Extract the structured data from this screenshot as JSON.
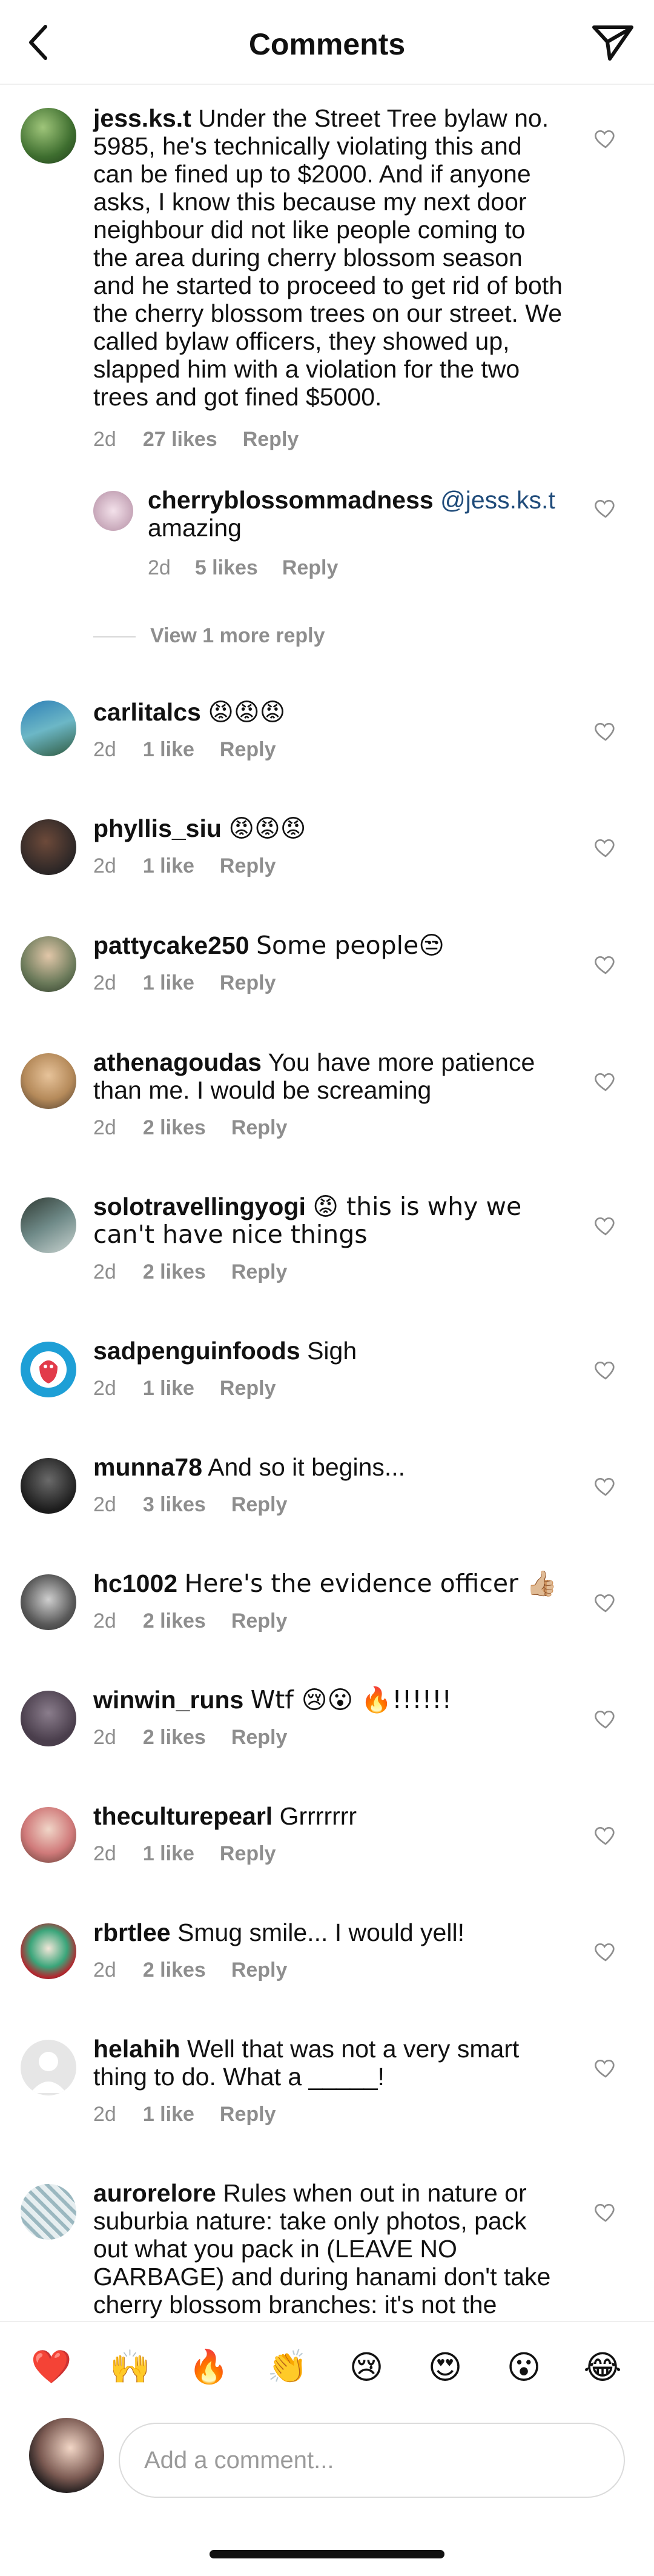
{
  "header": {
    "title": "Comments",
    "back_icon": "chevron-left-icon",
    "send_icon": "paper-plane-icon"
  },
  "comments": [
    {
      "user": "jess.ks.t",
      "text": "Under the Street Tree bylaw no. 5985, he's technically violating this and can be fined up to $2000.  And if anyone asks, I know this because my next door neighbour did not like people coming to the area during cherry blossom season and he started to proceed to get rid of both the  cherry blossom trees on our street.  We called bylaw officers, they showed up, slapped him with a violation for the two trees and got fined $5000.",
      "time": "2d",
      "likes": "27 likes",
      "reply": "Reply"
    },
    {
      "user": "cherryblossommadness",
      "mention": "@jess.ks.t",
      "text": "amazing",
      "time": "2d",
      "likes": "5 likes",
      "reply": "Reply"
    },
    {
      "user": "carlitalcs",
      "text": "😡😡😡",
      "time": "2d",
      "likes": "1 like",
      "reply": "Reply"
    },
    {
      "user": "phyllis_siu",
      "text": "😡😡😡",
      "time": "2d",
      "likes": "1 like",
      "reply": "Reply"
    },
    {
      "user": "pattycake250",
      "text": "Some people😒",
      "time": "2d",
      "likes": "1 like",
      "reply": "Reply"
    },
    {
      "user": "athenagoudas",
      "text": "You have more patience than me. I would be screaming",
      "time": "2d",
      "likes": "2 likes",
      "reply": "Reply"
    },
    {
      "user": "solotravellingyogi",
      "text": "😡 this is why we can't have nice things",
      "time": "2d",
      "likes": "2 likes",
      "reply": "Reply"
    },
    {
      "user": "sadpenguinfoods",
      "text": "Sigh",
      "time": "2d",
      "likes": "1 like",
      "reply": "Reply"
    },
    {
      "user": "munna78",
      "text": "And so it begins...",
      "time": "2d",
      "likes": "3 likes",
      "reply": "Reply"
    },
    {
      "user": "hc1002",
      "text": "Here's the evidence officer 👍🏼",
      "time": "2d",
      "likes": "2 likes",
      "reply": "Reply"
    },
    {
      "user": "winwin_runs",
      "text": "Wtf 😢😮 🔥!!!!!!",
      "time": "2d",
      "likes": "2 likes",
      "reply": "Reply"
    },
    {
      "user": "theculturepearl",
      "text": "Grrrrrrr",
      "time": "2d",
      "likes": "1 like",
      "reply": "Reply"
    },
    {
      "user": "rbrtlee",
      "text": "Smug smile... I would yell!",
      "time": "2d",
      "likes": "2 likes",
      "reply": "Reply"
    },
    {
      "user": "helahih",
      "text": "Well that was not a very smart thing to do. What a _____!",
      "time": "2d",
      "likes": "1 like",
      "reply": "Reply"
    },
    {
      "user": "aurorelore",
      "text": "Rules when out in nature or suburbia nature: take only photos,  pack out what you pack in (LEAVE NO GARBAGE) and during hanami  don't take cherry blossom branches: it's not the",
      "time": "",
      "likes": "",
      "reply": ""
    }
  ],
  "view_more": "View 1 more reply",
  "reactions": [
    "❤️",
    "🙌",
    "🔥",
    "👏",
    "😢",
    "😍",
    "😮",
    "😂"
  ],
  "composer": {
    "placeholder": "Add a comment..."
  },
  "colors": {
    "mention": "#1f4b7a",
    "meta": "#8e8e8e",
    "heart_red": "#e0245e"
  }
}
